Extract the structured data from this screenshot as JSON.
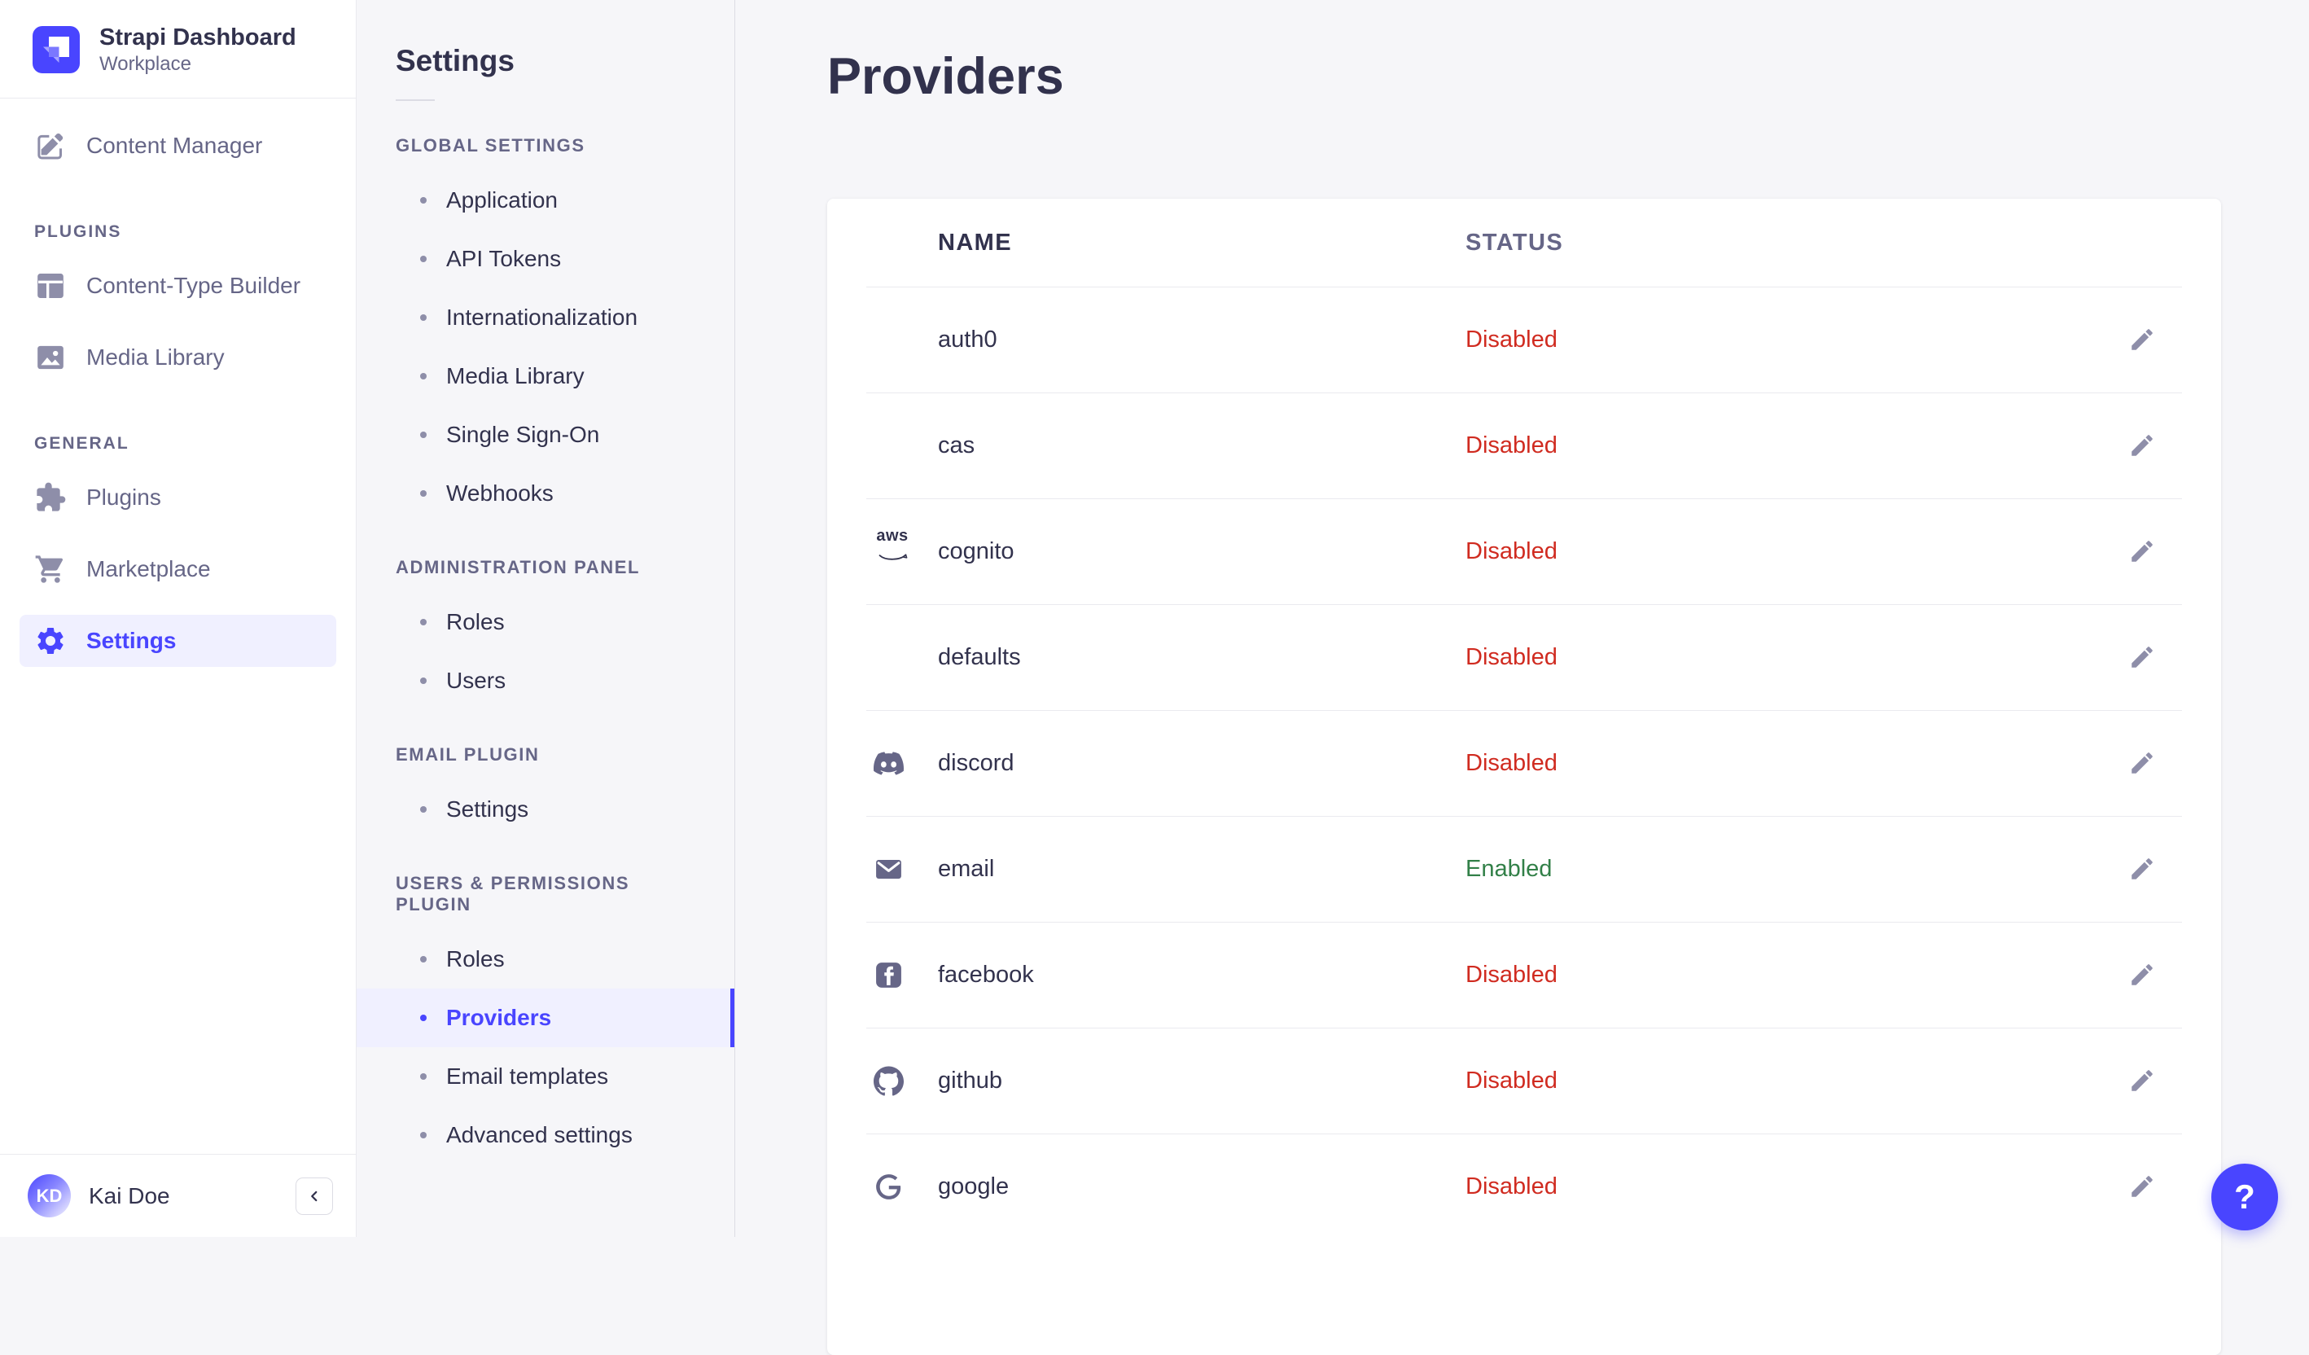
{
  "colors": {
    "accent": "#4945ff",
    "accent_bg": "#f0f0ff",
    "status_enabled": "#328048",
    "status_disabled": "#d02b20"
  },
  "app": {
    "name": "Strapi Dashboard",
    "workspace": "Workplace",
    "user": {
      "name": "Kai Doe",
      "initials": "KD"
    },
    "help_label": "?"
  },
  "sidebar": {
    "groups": [
      {
        "title": null,
        "items": [
          {
            "label": "Content Manager",
            "icon": "content-manager",
            "active": false
          }
        ]
      },
      {
        "title": "PLUGINS",
        "items": [
          {
            "label": "Content-Type Builder",
            "icon": "content-type-builder",
            "active": false
          },
          {
            "label": "Media Library",
            "icon": "media-library",
            "active": false
          }
        ]
      },
      {
        "title": "GENERAL",
        "items": [
          {
            "label": "Plugins",
            "icon": "plugins",
            "active": false
          },
          {
            "label": "Marketplace",
            "icon": "marketplace",
            "active": false
          },
          {
            "label": "Settings",
            "icon": "settings",
            "active": true
          }
        ]
      }
    ]
  },
  "subnav": {
    "title": "Settings",
    "sections": [
      {
        "title": "GLOBAL SETTINGS",
        "items": [
          {
            "label": "Application",
            "active": false
          },
          {
            "label": "API Tokens",
            "active": false
          },
          {
            "label": "Internationalization",
            "active": false
          },
          {
            "label": "Media Library",
            "active": false
          },
          {
            "label": "Single Sign-On",
            "active": false
          },
          {
            "label": "Webhooks",
            "active": false
          }
        ]
      },
      {
        "title": "ADMINISTRATION PANEL",
        "items": [
          {
            "label": "Roles",
            "active": false
          },
          {
            "label": "Users",
            "active": false
          }
        ]
      },
      {
        "title": "EMAIL PLUGIN",
        "items": [
          {
            "label": "Settings",
            "active": false
          }
        ]
      },
      {
        "title": "USERS & PERMISSIONS PLUGIN",
        "items": [
          {
            "label": "Roles",
            "active": false
          },
          {
            "label": "Providers",
            "active": true
          },
          {
            "label": "Email templates",
            "active": false
          },
          {
            "label": "Advanced settings",
            "active": false
          }
        ]
      }
    ]
  },
  "main": {
    "title": "Providers",
    "table": {
      "columns": [
        "NAME",
        "STATUS"
      ],
      "rows": [
        {
          "name": "auth0",
          "status": "Disabled",
          "icon": null
        },
        {
          "name": "cas",
          "status": "Disabled",
          "icon": null
        },
        {
          "name": "cognito",
          "status": "Disabled",
          "icon": "aws"
        },
        {
          "name": "defaults",
          "status": "Disabled",
          "icon": null
        },
        {
          "name": "discord",
          "status": "Disabled",
          "icon": "discord"
        },
        {
          "name": "email",
          "status": "Enabled",
          "icon": "email"
        },
        {
          "name": "facebook",
          "status": "Disabled",
          "icon": "facebook"
        },
        {
          "name": "github",
          "status": "Disabled",
          "icon": "github"
        },
        {
          "name": "google",
          "status": "Disabled",
          "icon": "google"
        }
      ]
    }
  }
}
